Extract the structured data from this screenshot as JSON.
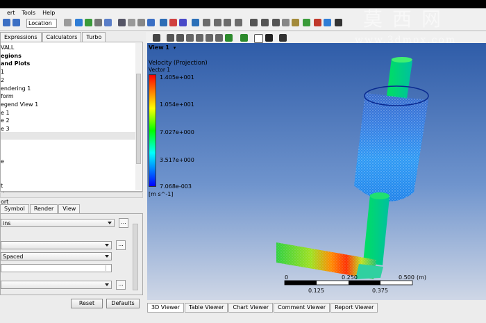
{
  "menu": [
    "ert",
    "Tools",
    "Help"
  ],
  "toolbar": {
    "location_label": "Location"
  },
  "left_tabs": [
    "Expressions",
    "Calculators",
    "Turbo"
  ],
  "tree_items": [
    {
      "text": "VALL",
      "bold": false
    },
    {
      "text": "egions",
      "bold": true
    },
    {
      "text": "and Plots",
      "bold": true
    },
    {
      "text": "1",
      "bold": false
    },
    {
      "text": "2",
      "bold": false
    },
    {
      "text": "endering 1",
      "bold": false
    },
    {
      "text": "form",
      "bold": false
    },
    {
      "text": "egend View 1",
      "bold": false
    },
    {
      "text": "e 1",
      "bold": false
    },
    {
      "text": "e 2",
      "bold": false
    },
    {
      "text": "e 3",
      "bold": false
    },
    {
      "text": "",
      "bold": false
    },
    {
      "text": "",
      "bold": false
    },
    {
      "text": "",
      "bold": false
    },
    {
      "text": "e",
      "bold": false
    },
    {
      "text": "",
      "bold": false
    },
    {
      "text": "",
      "bold": false
    },
    {
      "text": "t",
      "bold": false
    },
    {
      "text": "rt",
      "bold": false
    },
    {
      "text": "ort",
      "bold": false
    }
  ],
  "bottom_tabs": [
    "Symbol",
    "Render",
    "View"
  ],
  "props": {
    "combo1": "ins",
    "combo3": "Spaced",
    "reset": "Reset",
    "defaults": "Defaults"
  },
  "viewer": {
    "view_title": "View 1",
    "legend_title": "Velocity (Projection)",
    "legend_var": "Vector 1",
    "legend_ticks": [
      "1.405e+001",
      "1.054e+001",
      "7.027e+000",
      "3.517e+000",
      "7.068e-003"
    ],
    "legend_unit": "[m s^-1]",
    "scale_top": [
      "0",
      "0.250",
      "0.500",
      "(m)"
    ],
    "scale_bottom": [
      "0.125",
      "0.375"
    ]
  },
  "viewer_tabs": [
    "3D Viewer",
    "Table Viewer",
    "Chart Viewer",
    "Comment Viewer",
    "Report Viewer"
  ],
  "watermark": {
    "cn": "莫西网",
    "url": "www.3dmox.com"
  }
}
